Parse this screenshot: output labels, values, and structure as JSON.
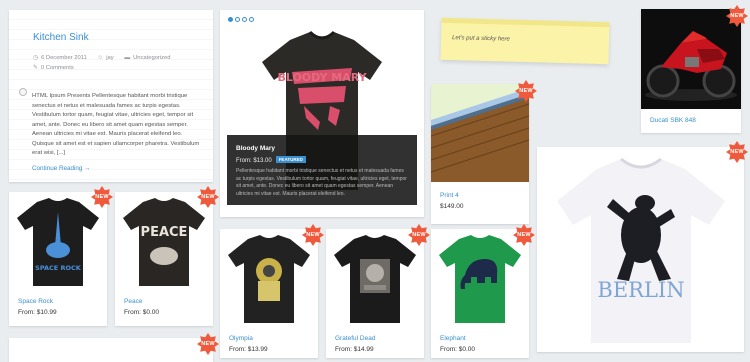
{
  "blog_post": {
    "title": "Kitchen Sink",
    "date": "6 December 2011",
    "author": "jay",
    "category": "Uncategorized",
    "comments": "0 Comments",
    "excerpt": "HTML Ipsum Presents Pellentesque habitant morbi tristique senectus et netus et malesuada fames ac turpis egestas. Vestibulum tortor quam, feugiat vitae, ultricies eget, tempor sit amet, ante. Donec eu libero sit amet quam egestas semper. Aenean ultricies mi vitae est. Mauris placerat eleifend leo. Quisque sit amet est et sapien ullamcorper pharetra. Vestibulum erat wisi, [...]",
    "continue_label": "Continue Reading →"
  },
  "featured": {
    "title": "Bloody Mary",
    "price": "From: $13.00",
    "tag": "FEATURED",
    "description": "Pellentesque habitant morbi tristique senectus et netus et malesuada fames ac turpis egestas. Vestibulum tortor quam, feugiat vitae, ultricies eget, tempor sit amet, ante. Donec eu libero sit amet quam egestas semper. Aenean ultricies mi vitae est. Mauris placerat eleifend leo.",
    "slider_dots": 4,
    "active_dot": 0
  },
  "sticky_note": {
    "text": "Let's put a sticky here"
  },
  "badge_label": "NEW",
  "colors": {
    "link": "#3a8fd1",
    "badge": "#f05a3c",
    "tag": "#3a8fd1"
  },
  "products": {
    "print4": {
      "title": "Print 4",
      "price": "$149.00"
    },
    "ducati": {
      "title": "Ducati SBK 848"
    },
    "space_rock": {
      "title": "Space Rock",
      "price": "From: $10.99"
    },
    "peace": {
      "title": "Peace",
      "price": "From: $0.00"
    },
    "olympia": {
      "title": "Olympia",
      "price": "From: $13.99"
    },
    "grateful_dead": {
      "title": "Grateful Dead",
      "price": "From: $14.99"
    },
    "elephant": {
      "title": "Elephant",
      "price": "From: $0.00"
    }
  },
  "shirt_prints": {
    "space_rock": "SPACE ROCK",
    "peace": "PEACE",
    "berlin": "BERLIN",
    "bloody_mary": "BLOODY MARY"
  }
}
